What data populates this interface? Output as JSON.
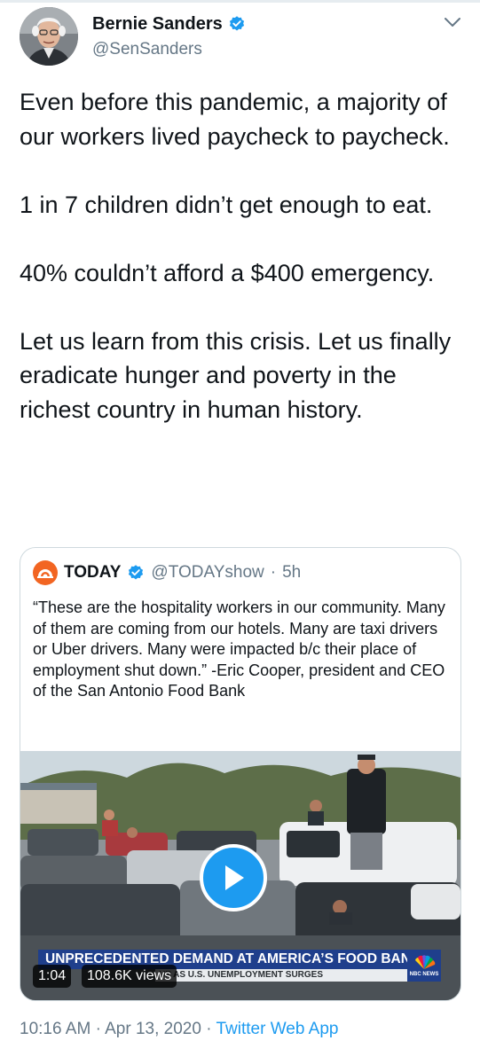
{
  "author": {
    "name": "Bernie Sanders",
    "handle": "@SenSanders"
  },
  "tweet": {
    "text": "Even before this pandemic, a majority of our workers lived paycheck to paycheck.\n\n1 in 7 children didn’t get enough to eat.\n\n40% couldn’t afford a $400 emergency.\n\nLet us learn from this crisis. Let us finally eradicate hunger and poverty in the richest country in human history."
  },
  "quoted_tweet": {
    "name": "TODAY",
    "handle": "@TODAYshow",
    "separator": "·",
    "time": "5h",
    "text": "“These are the hospitality workers in our community. Many of them are coming from our hotels. Many are taxi drivers or Uber drivers. Many were impacted b/c their place of employment shut down.” -Eric Cooper, president and CEO of the San Antonio Food Bank",
    "video": {
      "chyron": "UNPRECEDENTED DEMAND AT AMERICA’S FOOD BANKS",
      "subchyron": "UP AS U.S. UNEMPLOYMENT SURGES",
      "network_label": "NBC NEWS",
      "duration": "1:04",
      "views": "108.6K views"
    }
  },
  "footer": {
    "time": "10:16 AM",
    "separator1": "·",
    "date": "Apr 13, 2020",
    "separator2": "·",
    "source": "Twitter Web App"
  },
  "icons": {
    "verified": "verified-badge-icon",
    "menu": "chevron-down-icon",
    "play": "play-icon",
    "today_logo": "today-sunrise-logo",
    "nbc_logo": "nbc-peacock-logo"
  },
  "colors": {
    "accent": "#1d9bf0",
    "secondary_text": "#657786",
    "today_orange": "#f26522",
    "chyron_blue": "#1f3f8c"
  }
}
